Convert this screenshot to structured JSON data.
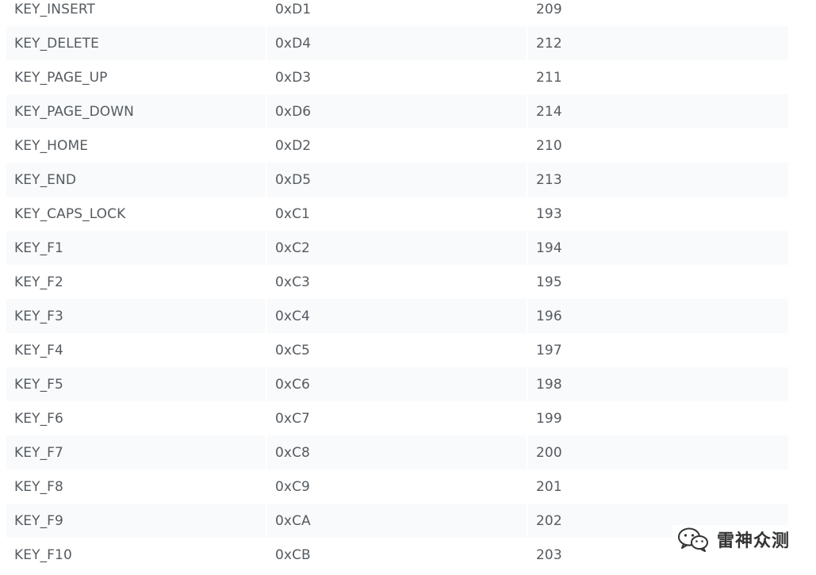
{
  "table": {
    "rows": [
      [
        "KEY_INSERT",
        "0xD1",
        "209"
      ],
      [
        "KEY_DELETE",
        "0xD4",
        "212"
      ],
      [
        "KEY_PAGE_UP",
        "0xD3",
        "211"
      ],
      [
        "KEY_PAGE_DOWN",
        "0xD6",
        "214"
      ],
      [
        "KEY_HOME",
        "0xD2",
        "210"
      ],
      [
        "KEY_END",
        "0xD5",
        "213"
      ],
      [
        "KEY_CAPS_LOCK",
        "0xC1",
        "193"
      ],
      [
        "KEY_F1",
        "0xC2",
        "194"
      ],
      [
        "KEY_F2",
        "0xC3",
        "195"
      ],
      [
        "KEY_F3",
        "0xC4",
        "196"
      ],
      [
        "KEY_F4",
        "0xC5",
        "197"
      ],
      [
        "KEY_F5",
        "0xC6",
        "198"
      ],
      [
        "KEY_F6",
        "0xC7",
        "199"
      ],
      [
        "KEY_F7",
        "0xC8",
        "200"
      ],
      [
        "KEY_F8",
        "0xC9",
        "201"
      ],
      [
        "KEY_F9",
        "0xCA",
        "202"
      ],
      [
        "KEY_F10",
        "0xCB",
        "203"
      ]
    ]
  },
  "watermark": {
    "text": "雷神众测",
    "icon": "wechat-icon"
  },
  "colors": {
    "text": "#555b60",
    "alt_row_bg": "#f8fafc",
    "watermark_text": "#333333"
  }
}
